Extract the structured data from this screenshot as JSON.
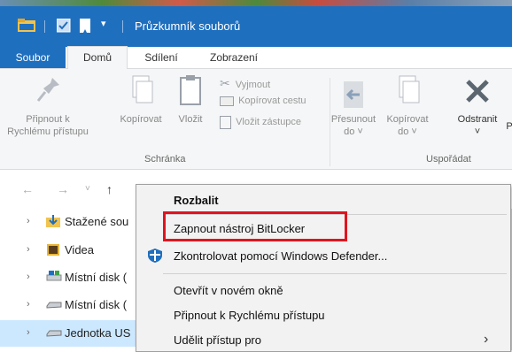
{
  "window": {
    "title": "Průzkumník souborů"
  },
  "tabs": [
    {
      "label": "Soubor"
    },
    {
      "label": "Domů"
    },
    {
      "label": "Sdílení"
    },
    {
      "label": "Zobrazení"
    }
  ],
  "ribbon": {
    "pin": "Připnout k Rychlému přístupu",
    "copy": "Kopírovat",
    "paste": "Vložit",
    "cut": "Vyjmout",
    "copy_path": "Kopírovat cestu",
    "paste_shortcut": "Vložit zástupce",
    "move_to": "Přesunout do ˅",
    "copy_to": "Kopírovat do ˅",
    "delete": "Odstranit",
    "delete_more": "˅",
    "rename": "P",
    "group_clipboard": "Schránka",
    "group_organize": "Uspořádat"
  },
  "tree": [
    {
      "label": "Stažené sou",
      "icon": "download-folder-icon"
    },
    {
      "label": "Videa",
      "icon": "video-folder-icon"
    },
    {
      "label": "Místní disk (",
      "icon": "local-disk-icon"
    },
    {
      "label": "Místní disk (",
      "icon": "drive-icon"
    },
    {
      "label": "Jednotka US",
      "icon": "usb-drive-icon"
    }
  ],
  "context_menu": {
    "expand": "Rozbalit",
    "bitlocker": "Zapnout nástroj BitLocker",
    "defender": "Zkontrolovat pomocí Windows Defender...",
    "open_new_window": "Otevřít v novém okně",
    "pin_quick": "Připnout k Rychlému přístupu",
    "grant_access": "Udělit přístup pro"
  },
  "colors": {
    "accent": "#1f6fbf",
    "highlight_box": "#e0141e",
    "selection": "#cce8ff"
  }
}
